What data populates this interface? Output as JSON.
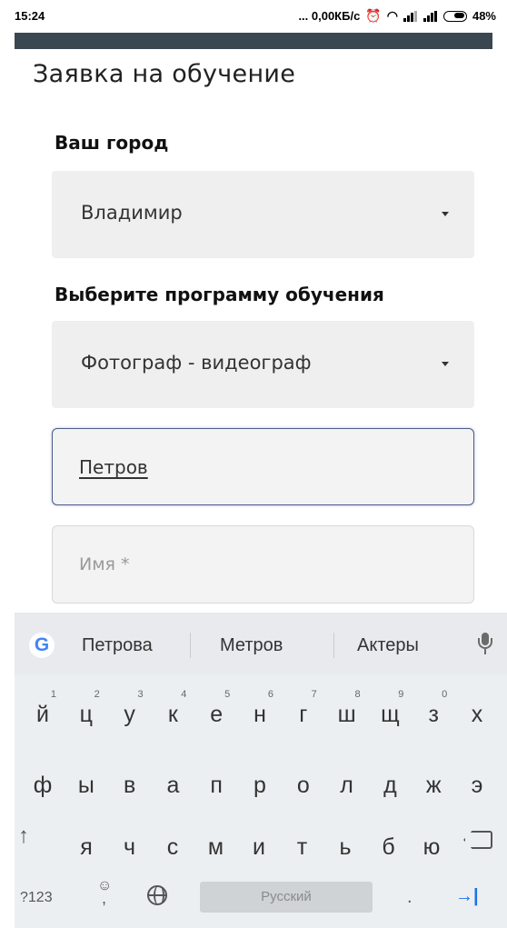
{
  "status_bar": {
    "time": "15:24",
    "network_speed": "... 0,00КБ/с",
    "battery": "48%"
  },
  "form": {
    "title": "Заявка на обучение",
    "city_label": "Ваш город",
    "city_value": "Владимир",
    "program_label": "Выберите программу обучения",
    "program_value": "Фотограф - видеограф",
    "lastname_value": "Петров",
    "firstname_placeholder": "Имя *"
  },
  "keyboard": {
    "suggestions": [
      "Петрова",
      "Метров",
      "Актеры"
    ],
    "row1": [
      "й",
      "ц",
      "у",
      "к",
      "е",
      "н",
      "г",
      "ш",
      "щ",
      "з",
      "х"
    ],
    "row1_hints": [
      "1",
      "2",
      "3",
      "4",
      "5",
      "6",
      "7",
      "8",
      "9",
      "0",
      ""
    ],
    "row2": [
      "ф",
      "ы",
      "в",
      "а",
      "п",
      "р",
      "о",
      "л",
      "д",
      "ж",
      "э"
    ],
    "row3": [
      "я",
      "ч",
      "с",
      "м",
      "и",
      "т",
      "ь",
      "б",
      "ю"
    ],
    "shift_symbol": "↑",
    "symbols_label": "?123",
    "emoji_symbol": "☺",
    "comma": ",",
    "period": ".",
    "space_label": "Русский",
    "enter_symbol": "→|"
  },
  "colors": {
    "strip": "#3a4750",
    "input_focus_border": "#4c5d88",
    "enter_key": "#1a73e8"
  }
}
